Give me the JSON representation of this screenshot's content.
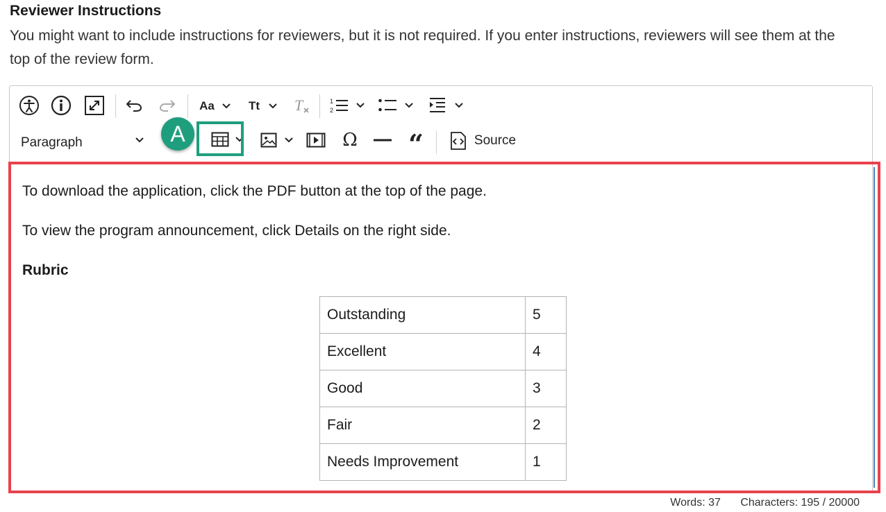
{
  "section": {
    "title": "Reviewer Instructions",
    "description": "You might want to include instructions for reviewers, but it is not required. If you enter instructions, reviewers will see them at the top of the review form."
  },
  "toolbar": {
    "font_family_label": "Aa",
    "font_size_label": "Tt",
    "heading_select_value": "Paragraph",
    "source_label": "Source",
    "icons": [
      "accessibility-icon",
      "info-icon",
      "fullscreen-icon",
      "undo-icon",
      "redo-icon",
      "font-family-icon",
      "font-size-icon",
      "remove-format-icon",
      "numbered-list-icon",
      "bulleted-list-icon",
      "indent-icon",
      "table-icon",
      "image-icon",
      "media-icon",
      "special-characters-icon",
      "horizontal-line-icon",
      "blockquote-icon",
      "source-icon"
    ]
  },
  "callout": {
    "label": "A",
    "color": "#1f9e7e"
  },
  "content": {
    "para1": "To download the application, click the PDF button at the top of the page.",
    "para2": "To view the program announcement, click Details on the right side.",
    "rubric_heading": "Rubric",
    "rubric": [
      {
        "label": "Outstanding",
        "value": "5"
      },
      {
        "label": "Excellent",
        "value": "4"
      },
      {
        "label": "Good",
        "value": "3"
      },
      {
        "label": "Fair",
        "value": "2"
      },
      {
        "label": "Needs Improvement",
        "value": "1"
      }
    ]
  },
  "footer": {
    "words": "Words: 37",
    "characters": "Characters: 195 / 20000"
  },
  "colors": {
    "highlight": "#e8434d",
    "accent": "#1f9e7e"
  }
}
